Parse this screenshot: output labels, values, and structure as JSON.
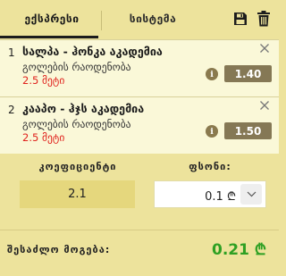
{
  "tabs": [
    {
      "label": "ექსპრესი",
      "active": true
    },
    {
      "label": "სისტემა",
      "active": false
    }
  ],
  "toolbar": {
    "save_icon": "save-icon",
    "delete_icon": "trash-icon"
  },
  "bets": [
    {
      "number": "1",
      "title": "სალპა - ჰონკა აკადემია",
      "market": "გოლების რაოდენობა",
      "selection": "2.5 მეტი",
      "odds": "1.40"
    },
    {
      "number": "2",
      "title": "კააპო - ჰჯს აკადემია",
      "market": "გოლების რაოდენობა",
      "selection": "2.5 მეტი",
      "odds": "1.50"
    }
  ],
  "info_glyph": "i",
  "summary": {
    "coefficient_label": "კოეფიციენტი",
    "coefficient_value": "2.1",
    "stake_label": "ფსონი:",
    "stake_value": "0.1 ₾",
    "possible_win_label": "შესაძლო მოგება:",
    "possible_win_value": "0.21 ₾"
  },
  "colors": {
    "background": "#ede39c",
    "bet_background": "#faf8d8",
    "odds_badge": "#857855",
    "selection_red": "#e0221d",
    "win_green": "#2ea023"
  }
}
